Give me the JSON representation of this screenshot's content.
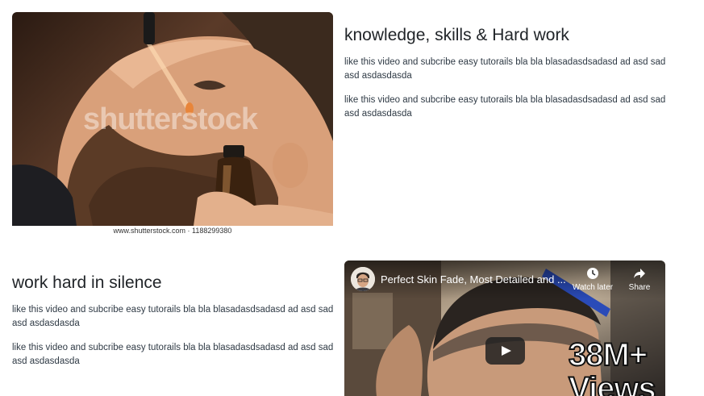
{
  "photo": {
    "watermark": "shutterstock",
    "caption": "www.shutterstock.com · 1188299380"
  },
  "section1": {
    "title": "knowledge, skills & Hard work",
    "paragraphs": [
      "like this video and subcribe easy tutorails bla bla blasadasdsadasd ad asd sad asd asdasdasda",
      "like this video and subcribe easy tutorails bla bla blasadasdsadasd ad asd sad asd asdasdasda"
    ]
  },
  "section2": {
    "title": "work hard in silence",
    "paragraphs": [
      "like this video and subcribe easy tutorails bla bla blasadasdsadasd ad asd sad asd asdasdasda",
      "like this video and subcribe easy tutorails bla bla blasadasdsadasd ad asd sad asd asdasdasda"
    ]
  },
  "video": {
    "title": "Perfect Skin Fade, Most Detailed and ...",
    "watch_later": "Watch later",
    "share": "Share",
    "views_line1": "38M+",
    "views_line2": "Views"
  }
}
